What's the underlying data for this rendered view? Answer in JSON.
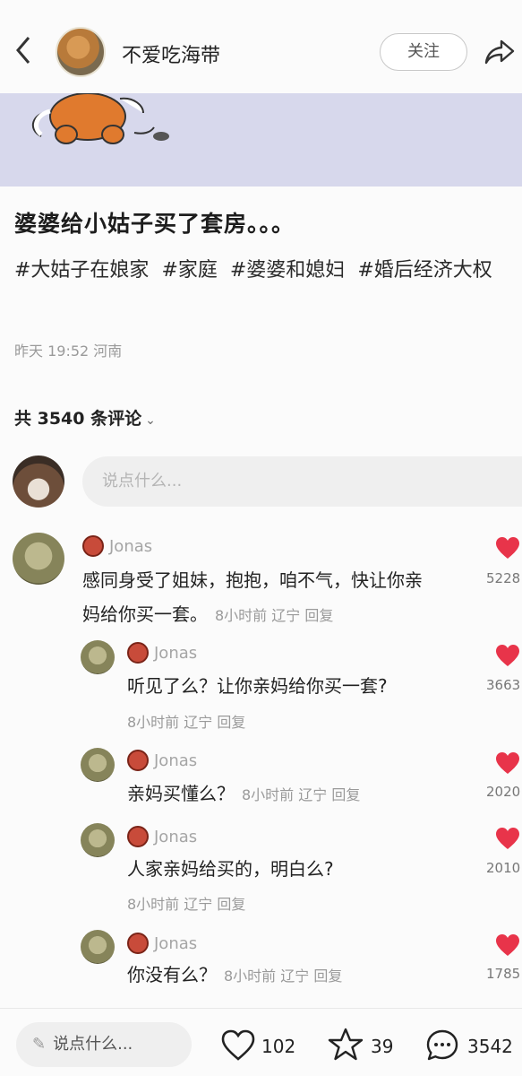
{
  "header": {
    "back_icon": "chevron-left-icon",
    "author_name": "不爱吃海带",
    "follow_label": "关注",
    "share_icon": "share-arrow-icon"
  },
  "post": {
    "title": "婆婆给小姑子买了套房。。。",
    "tags": [
      "#大姑子在娘家",
      "#家庭",
      "#婆婆和媳妇",
      "#婚后经济大权"
    ],
    "meta": "昨天 19:52 河南"
  },
  "comments_section": {
    "count_label": "共 3540 条评论",
    "chevron": "⌄",
    "input_placeholder": "说点什么..."
  },
  "comments": [
    {
      "name": "Jonas",
      "text_line1": "感同身受了姐妹，抱抱，咱不气，快让你亲",
      "text_line2": "妈给你买一套。",
      "meta": "8小时前 辽宁 回复",
      "likes": "5228"
    },
    {
      "name": "Jonas",
      "text": "听见了么？让你亲妈给你买一套?",
      "meta": "8小时前 辽宁 回复",
      "likes": "3663"
    },
    {
      "name": "Jonas",
      "text": "亲妈买懂么？",
      "meta": "8小时前 辽宁 回复",
      "likes": "2020"
    },
    {
      "name": "Jonas",
      "text": "人家亲妈给买的，明白么?",
      "meta": "8小时前 辽宁 回复",
      "likes": "2010"
    },
    {
      "name": "Jonas",
      "text": "你没有么？",
      "meta": "8小时前 辽宁 回复",
      "likes": "1785"
    }
  ],
  "bottom_bar": {
    "input_placeholder": "说点什么...",
    "likes_count": "102",
    "favorites_count": "39",
    "comments_count": "3542"
  },
  "colors": {
    "heart": "#e8344a",
    "banner": "#d7d8ec",
    "background": "#fbfbfb"
  }
}
